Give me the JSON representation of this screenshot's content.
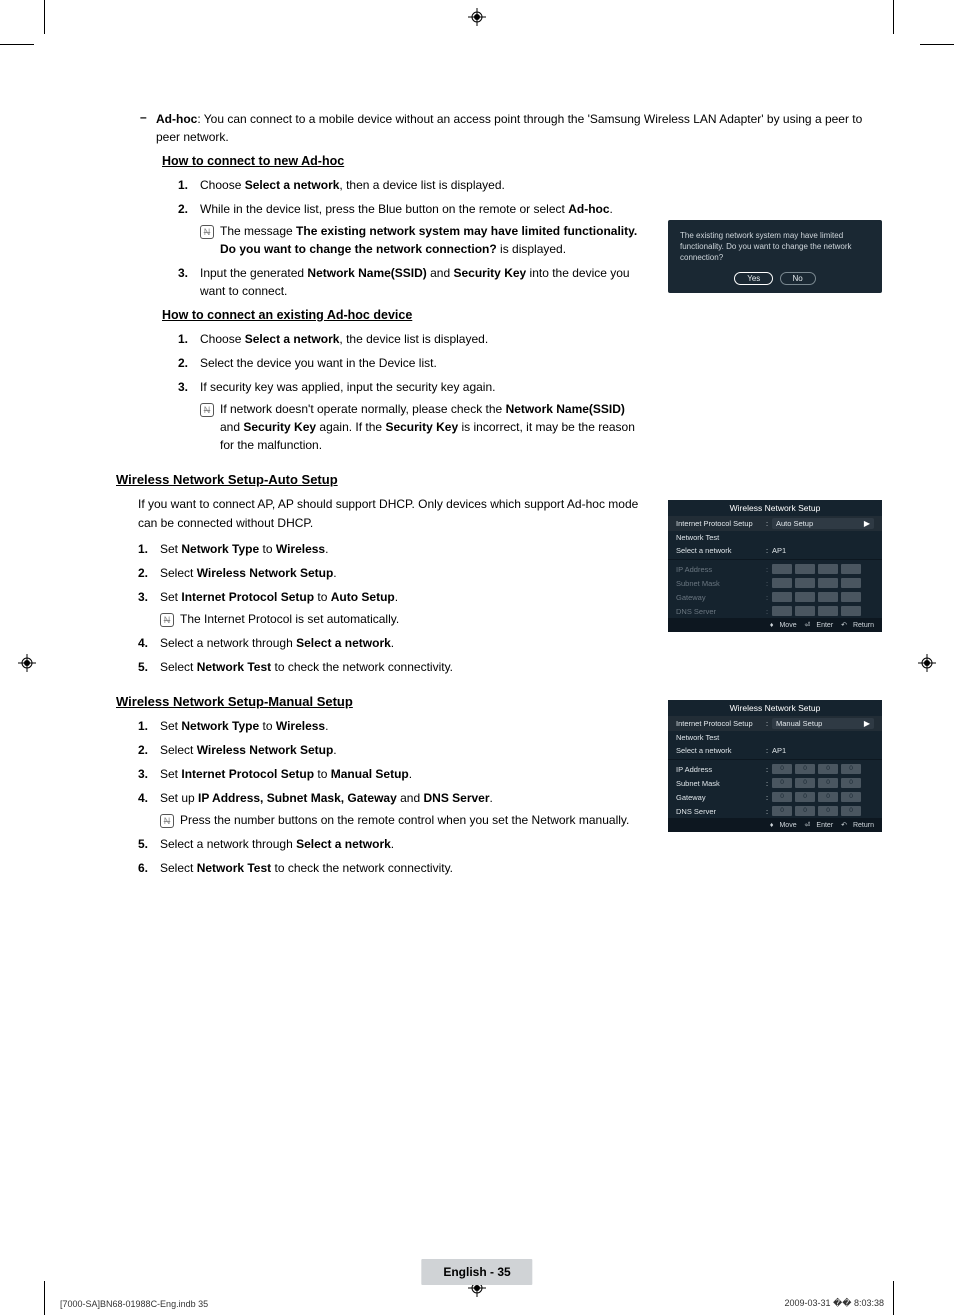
{
  "adhoc": {
    "intro_prefix": "Ad-hoc",
    "intro_text": ": You can connect to a mobile device without an access point through the 'Samsung Wireless LAN Adapter' by using a peer to peer network.",
    "connect_new_head": "How to connect to new Ad-hoc",
    "steps_new": {
      "s1_pre": "Choose ",
      "s1_b": "Select a network",
      "s1_post": ", then a device list is displayed.",
      "s2_pre": "While in the device list, press the Blue button on the remote or select ",
      "s2_b": "Ad-hoc",
      "s2_post": ".",
      "s2_note_pre": "The message ",
      "s2_note_b": "The existing network system may have limited functionality. Do you want to change the network connection?",
      "s2_note_post": " is displayed.",
      "s3_pre": "Input the generated ",
      "s3_b1": "Network Name(SSID)",
      "s3_mid": " and ",
      "s3_b2": "Security Key",
      "s3_post": " into the device you want to connect."
    },
    "connect_existing_head": "How to connect an existing Ad-hoc device",
    "steps_existing": {
      "s1_pre": "Choose ",
      "s1_b": "Select a network",
      "s1_post": ", the device list is displayed.",
      "s2": "Select the device you want in the Device list.",
      "s3": "If security key was applied, input the security key again.",
      "s3_note_pre": "If network doesn't operate normally, please check the ",
      "s3_note_b1": "Network Name(SSID)",
      "s3_note_mid1": " and ",
      "s3_note_b2": "Security Key",
      "s3_note_mid2": " again. If the ",
      "s3_note_b3": "Security Key",
      "s3_note_post": " is incorrect, it may be the reason for the malfunction."
    }
  },
  "auto": {
    "head": "Wireless Network Setup-Auto Setup",
    "intro": "If you want to connect AP, AP should support DHCP. Only devices which support Ad-hoc mode can be connected without DHCP.",
    "s1_pre": "Set ",
    "s1_b1": "Network Type",
    "s1_mid": " to ",
    "s1_b2": "Wireless",
    "s1_post": ".",
    "s2_pre": "Select ",
    "s2_b": "Wireless Network Setup",
    "s2_post": ".",
    "s3_pre": "Set ",
    "s3_b1": "Internet Protocol Setup",
    "s3_mid": " to ",
    "s3_b2": "Auto Setup",
    "s3_post": ".",
    "s3_note": "The Internet Protocol is set automatically.",
    "s4_pre": "Select a network through ",
    "s4_b": "Select a network",
    "s4_post": ".",
    "s5_pre": "Select ",
    "s5_b": "Network Test",
    "s5_post": " to check the network connectivity."
  },
  "manual": {
    "head": "Wireless Network Setup-Manual Setup",
    "s1_pre": "Set ",
    "s1_b1": "Network Type",
    "s1_mid": " to ",
    "s1_b2": "Wireless",
    "s1_post": ".",
    "s2_pre": "Select ",
    "s2_b": "Wireless Network Setup",
    "s2_post": ".",
    "s3_pre": "Set ",
    "s3_b1": "Internet Protocol Setup",
    "s3_mid": " to ",
    "s3_b2": "Manual Setup",
    "s3_post": ".",
    "s4_pre": "Set up ",
    "s4_b1": "IP Address, Subnet Mask, Gateway",
    "s4_mid": " and ",
    "s4_b2": "DNS Server",
    "s4_post": ".",
    "s4_note": "Press the number buttons on the remote control when you set the Network manually.",
    "s5_pre": "Select a network through ",
    "s5_b": "Select a network",
    "s5_post": ".",
    "s6_pre": "Select ",
    "s6_b": "Network Test",
    "s6_post": " to check the network connectivity."
  },
  "dialog": {
    "msg": "The existing network system may have limited functionality. Do you want to change the network connection?",
    "yes": "Yes",
    "no": "No"
  },
  "menu": {
    "title": "Wireless Network Setup",
    "ips": "Internet Protocol Setup",
    "auto": "Auto Setup",
    "manual": "Manual Setup",
    "ntest": "Network Test",
    "selnet": "Select a network",
    "ap1": "AP1",
    "ipaddr": "IP Address",
    "subnet": "Subnet Mask",
    "gateway": "Gateway",
    "dns": "DNS Server",
    "move": "Move",
    "enter": "Enter",
    "return": "Return",
    "zero": "0"
  },
  "footer": {
    "page": "English - 35",
    "left": "[7000-SA]BN68-01988C-Eng.indb   35",
    "right": "2009-03-31   �� 8:03:38"
  }
}
